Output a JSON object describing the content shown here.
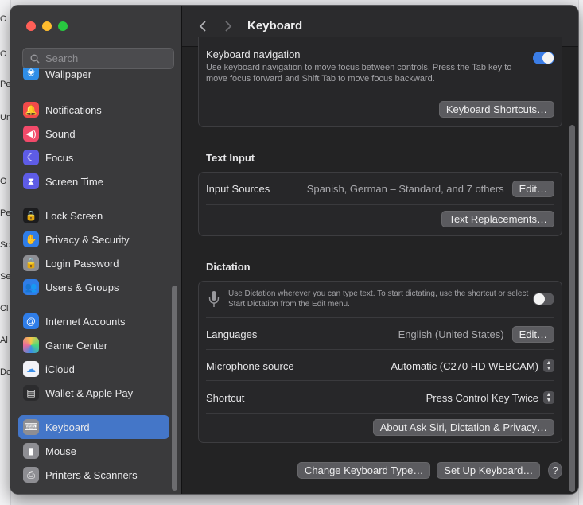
{
  "background_window": {
    "left_column_letters": [
      "O",
      "O",
      "Pe",
      "Un",
      "",
      "O",
      "Pe",
      "So",
      "Se",
      "Cl",
      "Al",
      "Do"
    ]
  },
  "window": {
    "traffic_lights": {
      "close_color": "#ff5f57",
      "minimize_color": "#febc2e",
      "zoom_color": "#28c840"
    },
    "title": "Keyboard",
    "search": {
      "placeholder": "Search",
      "value": ""
    }
  },
  "sidebar": {
    "items": [
      {
        "label": "Wallpaper",
        "icon": "wallpaper-icon",
        "color": "#2f8ee8"
      },
      {
        "label": "Notifications",
        "icon": "bell-icon",
        "color": "#f24a4a"
      },
      {
        "label": "Sound",
        "icon": "speaker-icon",
        "color": "#f24a6a"
      },
      {
        "label": "Focus",
        "icon": "moon-icon",
        "color": "#5e5ce6"
      },
      {
        "label": "Screen Time",
        "icon": "hourglass-icon",
        "color": "#5e5ce6"
      },
      {
        "label": "Lock Screen",
        "icon": "lock-icon",
        "color": "#1c1c1e"
      },
      {
        "label": "Privacy & Security",
        "icon": "hand-icon",
        "color": "#2f7de8"
      },
      {
        "label": "Login Password",
        "icon": "padlock-icon",
        "color": "#8e8e93"
      },
      {
        "label": "Users & Groups",
        "icon": "users-icon",
        "color": "#2f7de8"
      },
      {
        "label": "Internet Accounts",
        "icon": "at-icon",
        "color": "#2f7de8"
      },
      {
        "label": "Game Center",
        "icon": "game-center-icon",
        "color": "#e86a9a"
      },
      {
        "label": "iCloud",
        "icon": "cloud-icon",
        "color": "#f2f2f7"
      },
      {
        "label": "Wallet & Apple Pay",
        "icon": "wallet-icon",
        "color": "#2c2c2e"
      },
      {
        "label": "Keyboard",
        "icon": "keyboard-icon",
        "color": "#8e8e93",
        "selected": true
      },
      {
        "label": "Mouse",
        "icon": "mouse-icon",
        "color": "#8e8e93"
      },
      {
        "label": "Printers & Scanners",
        "icon": "printer-icon",
        "color": "#8e8e93"
      }
    ]
  },
  "keyboard_nav": {
    "title": "Keyboard navigation",
    "description": "Use keyboard navigation to move focus between controls. Press the Tab key to move focus forward and Shift Tab to move focus backward.",
    "enabled": true,
    "shortcuts_button": "Keyboard Shortcuts…"
  },
  "text_input": {
    "heading": "Text Input",
    "input_sources_label": "Input Sources",
    "input_sources_value": "Spanish, German – Standard, and 7 others",
    "edit_button": "Edit…",
    "replacements_button": "Text Replacements…"
  },
  "dictation": {
    "heading": "Dictation",
    "description": "Use Dictation wherever you can type text. To start dictating, use the shortcut or select Start Dictation from the Edit menu.",
    "enabled": false,
    "languages_label": "Languages",
    "languages_value": "English (United States)",
    "languages_edit": "Edit…",
    "mic_label": "Microphone source",
    "mic_value": "Automatic (C270 HD WEBCAM)",
    "shortcut_label": "Shortcut",
    "shortcut_value": "Press Control Key Twice",
    "about_button": "About Ask Siri, Dictation & Privacy…"
  },
  "footer": {
    "change_type_button": "Change Keyboard Type…",
    "setup_button": "Set Up Keyboard…",
    "help_label": "?"
  }
}
